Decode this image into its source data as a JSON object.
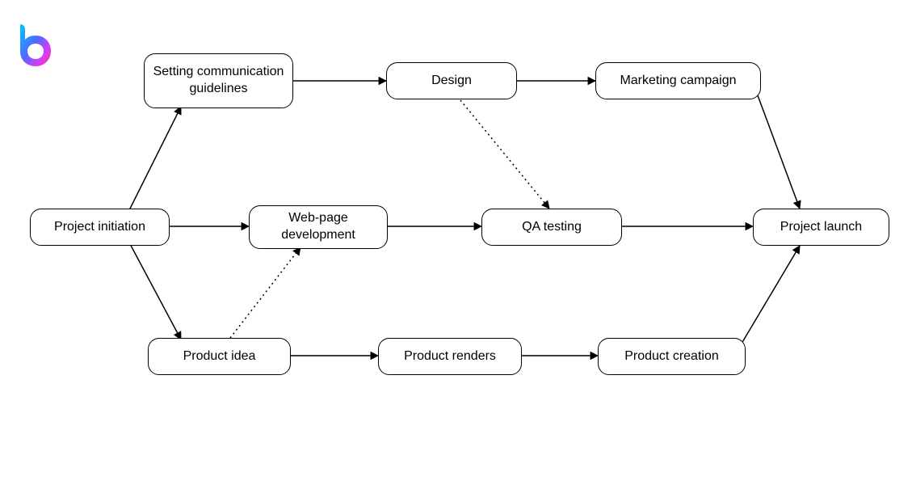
{
  "logo": {
    "name": "b-logo"
  },
  "nodes": {
    "project_initiation": "Project initiation",
    "setting_guidelines": "Setting communication guidelines",
    "design": "Design",
    "marketing": "Marketing campaign",
    "webpage_dev": "Web-page development",
    "qa_testing": "QA testing",
    "project_launch": "Project launch",
    "product_idea": "Product idea",
    "product_renders": "Product renders",
    "product_creation": "Product creation"
  },
  "edges": [
    {
      "from": "project_initiation",
      "to": "setting_guidelines",
      "style": "solid"
    },
    {
      "from": "project_initiation",
      "to": "webpage_dev",
      "style": "solid"
    },
    {
      "from": "project_initiation",
      "to": "product_idea",
      "style": "solid"
    },
    {
      "from": "setting_guidelines",
      "to": "design",
      "style": "solid"
    },
    {
      "from": "design",
      "to": "marketing",
      "style": "solid"
    },
    {
      "from": "design",
      "to": "qa_testing",
      "style": "dotted"
    },
    {
      "from": "webpage_dev",
      "to": "qa_testing",
      "style": "solid"
    },
    {
      "from": "product_idea",
      "to": "webpage_dev",
      "style": "dotted"
    },
    {
      "from": "product_idea",
      "to": "product_renders",
      "style": "solid"
    },
    {
      "from": "product_renders",
      "to": "product_creation",
      "style": "solid"
    },
    {
      "from": "marketing",
      "to": "project_launch",
      "style": "solid"
    },
    {
      "from": "qa_testing",
      "to": "project_launch",
      "style": "solid"
    },
    {
      "from": "product_creation",
      "to": "project_launch",
      "style": "solid"
    }
  ]
}
